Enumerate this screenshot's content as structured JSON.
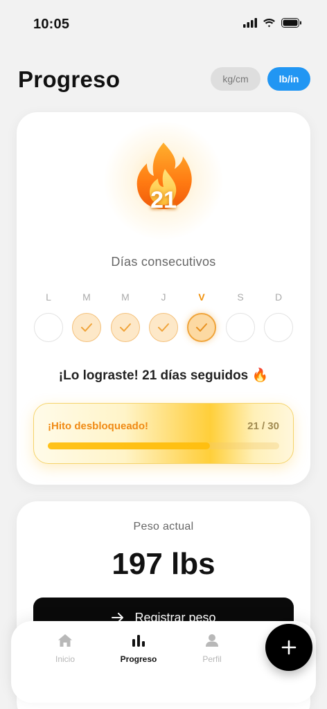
{
  "status_bar": {
    "time": "10:05"
  },
  "header": {
    "title": "Progreso",
    "units": [
      {
        "label": "kg/cm",
        "active": false
      },
      {
        "label": "lb/in",
        "active": true
      }
    ]
  },
  "streak": {
    "count": "21",
    "label": "Días consecutivos",
    "days": [
      {
        "letter": "L",
        "state": "empty"
      },
      {
        "letter": "M",
        "state": "done"
      },
      {
        "letter": "M",
        "state": "done"
      },
      {
        "letter": "J",
        "state": "done"
      },
      {
        "letter": "V",
        "state": "today"
      },
      {
        "letter": "S",
        "state": "empty"
      },
      {
        "letter": "D",
        "state": "empty"
      }
    ],
    "message": "¡Lo lograste! 21 días seguidos 🔥",
    "milestone": {
      "label": "¡Hito desbloqueado!",
      "count": "21 / 30",
      "progress": 0.7
    }
  },
  "weight": {
    "label": "Peso actual",
    "value": "197 lbs",
    "register_label": "Registrar peso"
  },
  "tabs": [
    {
      "label": "Inicio",
      "icon": "home-icon",
      "active": false
    },
    {
      "label": "Progreso",
      "icon": "bar-chart-icon",
      "active": true
    },
    {
      "label": "Perfil",
      "icon": "person-icon",
      "active": false
    }
  ],
  "colors": {
    "accent_blue": "#2196f3",
    "streak_orange": "#f08a14",
    "milestone_yellow": "#ffc21a"
  }
}
